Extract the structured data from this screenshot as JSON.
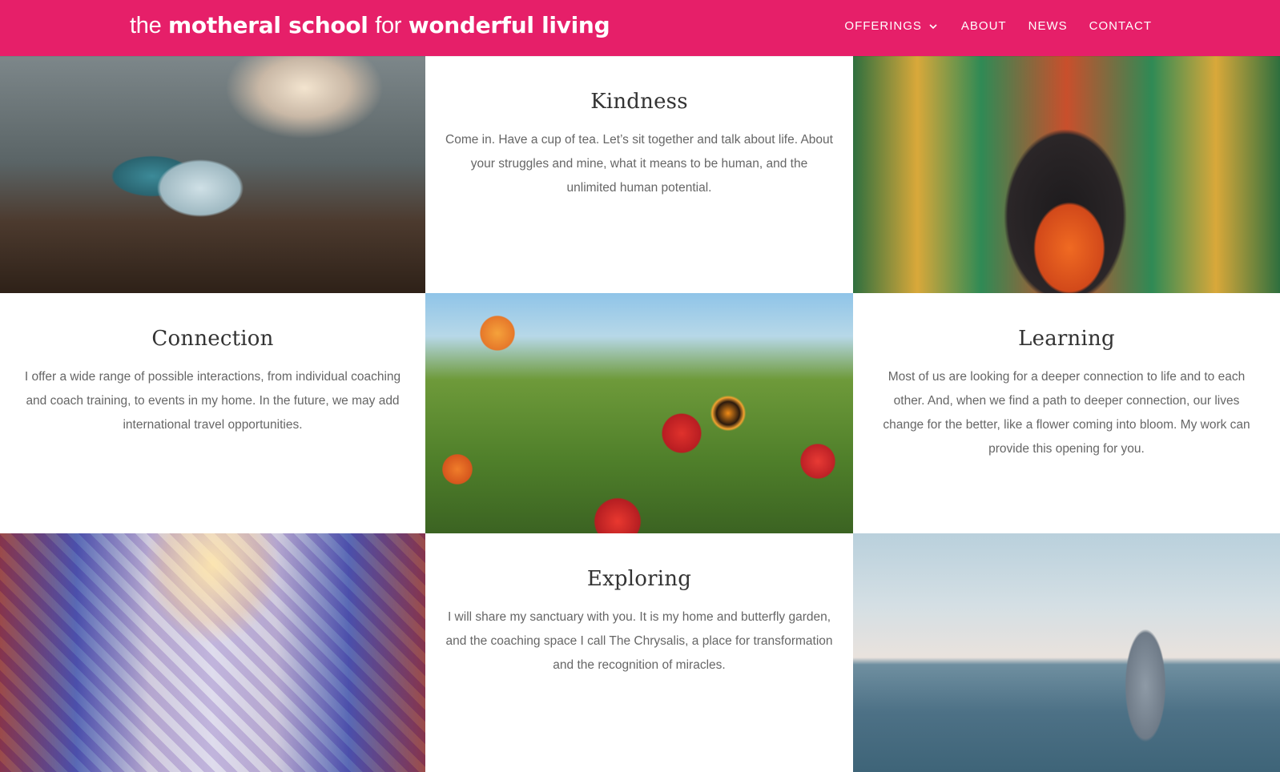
{
  "header": {
    "logo": {
      "the": "the",
      "motheral_school": "motheral school",
      "for": "for",
      "wonderful_living": "wonderful living"
    },
    "nav": [
      {
        "label": "OFFERINGS",
        "has_dropdown": true
      },
      {
        "label": "ABOUT"
      },
      {
        "label": "NEWS"
      },
      {
        "label": "CONTACT"
      }
    ]
  },
  "sections": {
    "kindness": {
      "title": "Kindness",
      "body": "Come in. Have a cup of tea. Let’s sit together and talk about life. About your struggles and mine, what it means to be human, and the unlimited human potential."
    },
    "connection": {
      "title": "Connection",
      "body": "I offer a wide range of possible interactions, from individual coaching and coach training, to events in my home. In the future, we may add international travel opportunities."
    },
    "learning": {
      "title": "Learning",
      "body": "Most of us are looking for a deeper connection to life and to each other. And, when we find a path to deeper connection, our lives change for the better, like a flower coming into bloom. My work can provide this opening for you."
    },
    "exploring": {
      "title": "Exploring",
      "body": "I will share my sanctuary with you. It is my home and butterfly garden, and the coaching space I call The Chrysalis, a place for transformation and the recognition of miracles."
    }
  },
  "colors": {
    "brand": "#e61f69",
    "heading": "#333333",
    "body_text": "#666666"
  }
}
